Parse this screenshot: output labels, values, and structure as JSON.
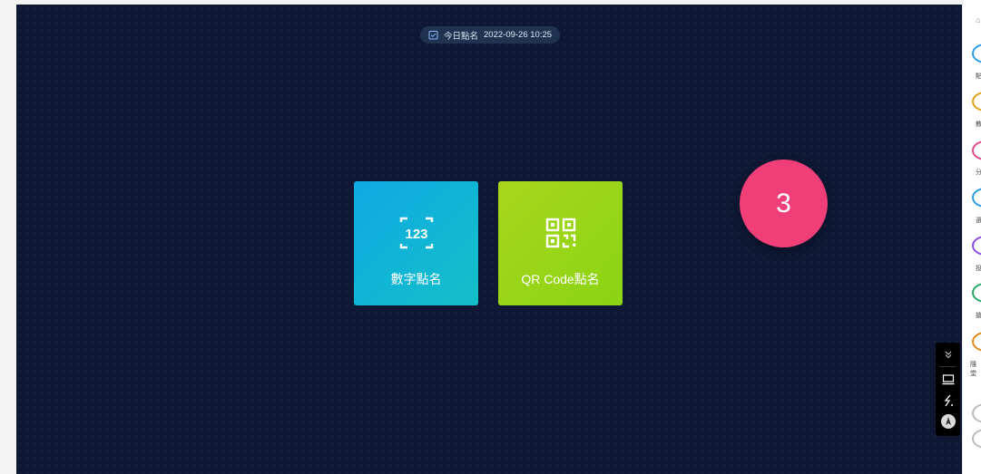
{
  "header": {
    "date_icon": "calendar-check-icon",
    "title": "今日點名",
    "datetime": "2022-09-26 10:25"
  },
  "cards": [
    {
      "id": "digit",
      "label": "數字點名",
      "icon": "number-123-icon",
      "color": "#0fa9e3"
    },
    {
      "id": "qr",
      "label": "QR Code點名",
      "icon": "qr-code-icon",
      "color": "#a8d61b"
    }
  ],
  "badge": {
    "value": "3",
    "color": "#f03e79"
  },
  "floating_toolbar": {
    "items": [
      "collapse-icon",
      "screen-icon",
      "pen-icon",
      "pointer-icon"
    ]
  },
  "right_rail": {
    "items": [
      {
        "icon": "user-icon",
        "color": "#2b9be8",
        "label": "點"
      },
      {
        "icon": "document-icon",
        "color": "#e3a117",
        "label": "教"
      },
      {
        "icon": "chart-icon",
        "color": "#e3488b",
        "label": "分"
      },
      {
        "icon": "group-icon",
        "color": "#2b9be8",
        "label": "選"
      },
      {
        "icon": "shape-icon",
        "color": "#8a4be8",
        "label": "投"
      },
      {
        "icon": "leaf-icon",
        "color": "#2aa86a",
        "label": "搶"
      },
      {
        "icon": "box-icon",
        "color": "#e38a17",
        "label": "隨堂"
      }
    ]
  }
}
